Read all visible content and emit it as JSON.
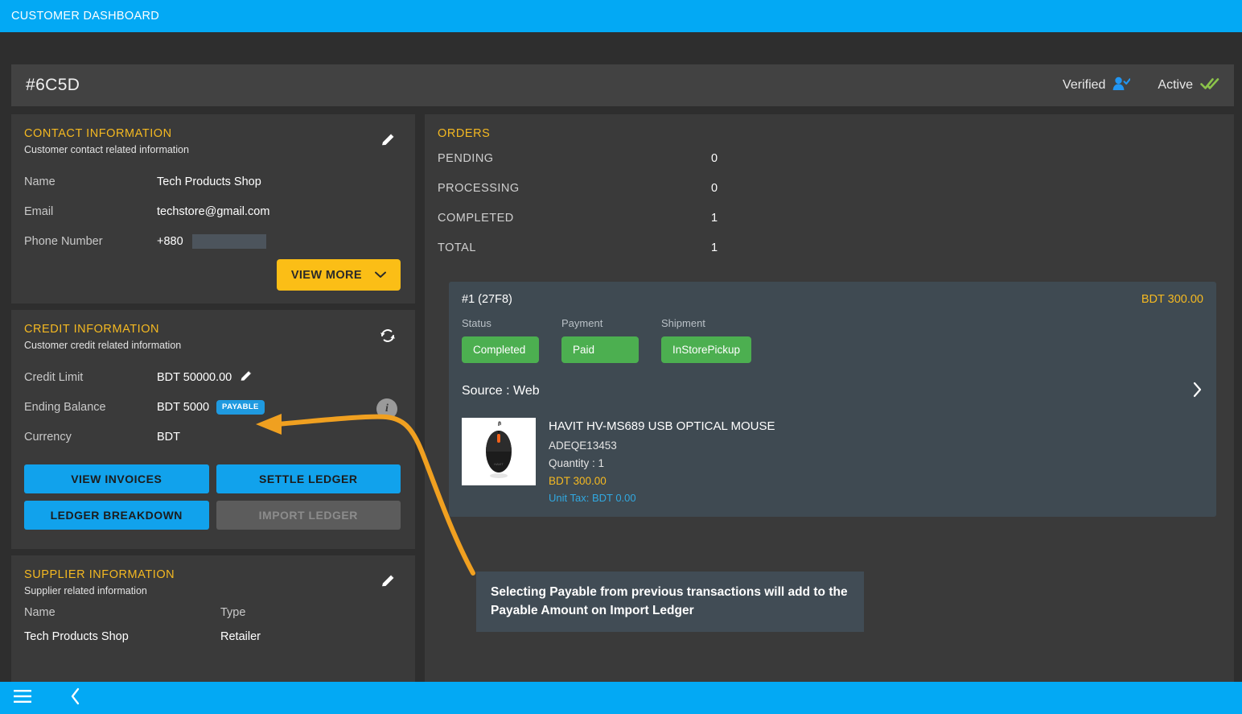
{
  "topbar": {
    "title": "CUSTOMER DASHBOARD"
  },
  "header": {
    "customer_id": "#6C5D",
    "verified_label": "Verified",
    "verified_icon": "user-check-icon",
    "active_label": "Active",
    "active_icon": "double-check-icon"
  },
  "contact": {
    "title": "CONTACT INFORMATION",
    "subtitle": "Customer contact related information",
    "edit_icon": "pencil-icon",
    "rows": [
      {
        "label": "Name",
        "value": "Tech Products Shop"
      },
      {
        "label": "Email",
        "value": "techstore@gmail.com"
      },
      {
        "label": "Phone Number",
        "value": "+880"
      }
    ],
    "view_more_label": "VIEW MORE",
    "view_more_icon": "chevron-down-icon"
  },
  "credit": {
    "title": "CREDIT INFORMATION",
    "subtitle": "Customer credit related information",
    "sync_icon": "refresh-icon",
    "info_icon": "info-icon",
    "credit_limit_label": "Credit Limit",
    "credit_limit_value": "BDT 50000.00",
    "credit_limit_edit_icon": "pencil-icon",
    "ending_balance_label": "Ending Balance",
    "ending_balance_value": "BDT 5000",
    "ending_balance_badge": "PAYABLE",
    "currency_label": "Currency",
    "currency_value": "BDT",
    "buttons": [
      {
        "label": "VIEW INVOICES",
        "disabled": false
      },
      {
        "label": "SETTLE LEDGER",
        "disabled": false
      },
      {
        "label": "LEDGER BREAKDOWN",
        "disabled": false
      },
      {
        "label": "IMPORT LEDGER",
        "disabled": true
      }
    ]
  },
  "supplier": {
    "title": "SUPPLIER INFORMATION",
    "subtitle": "Supplier related information",
    "edit_icon": "pencil-icon",
    "col_name": "Name",
    "col_type": "Type",
    "row_name": "Tech Products Shop",
    "row_type": "Retailer"
  },
  "orders": {
    "title": "ORDERS",
    "stats": [
      {
        "label": "PENDING",
        "value": "0"
      },
      {
        "label": "PROCESSING",
        "value": "0"
      },
      {
        "label": "COMPLETED",
        "value": "1"
      },
      {
        "label": "TOTAL",
        "value": "1"
      }
    ],
    "card": {
      "order_no": "#1 (27F8)",
      "amount": "BDT 300.00",
      "status_label": "Status",
      "status_value": "Completed",
      "payment_label": "Payment",
      "payment_value": "Paid",
      "shipment_label": "Shipment",
      "shipment_value": "InStorePickup",
      "source": "Source : Web",
      "expand_icon": "chevron-right-icon",
      "product": {
        "image_icon": "computer-mouse-photo",
        "name": "HAVIT HV-MS689 USB OPTICAL MOUSE",
        "sku": "ADEQE13453",
        "quantity": "Quantity : 1",
        "price": "BDT 300.00",
        "unit_tax": "Unit Tax: BDT 0.00"
      }
    }
  },
  "annotation": {
    "text": "Selecting Payable from previous transactions will add to the Payable Amount on Import Ledger",
    "arrow_color": "#f0a020"
  },
  "footer": {
    "menu_icon": "hamburger-menu-icon",
    "back_icon": "chevron-left-icon"
  },
  "colors": {
    "accent_blue": "#03a9f4",
    "accent_amber": "#f5b921",
    "status_green": "#4caf50",
    "panel": "#3a3a3a",
    "card": "#3f4a52"
  }
}
